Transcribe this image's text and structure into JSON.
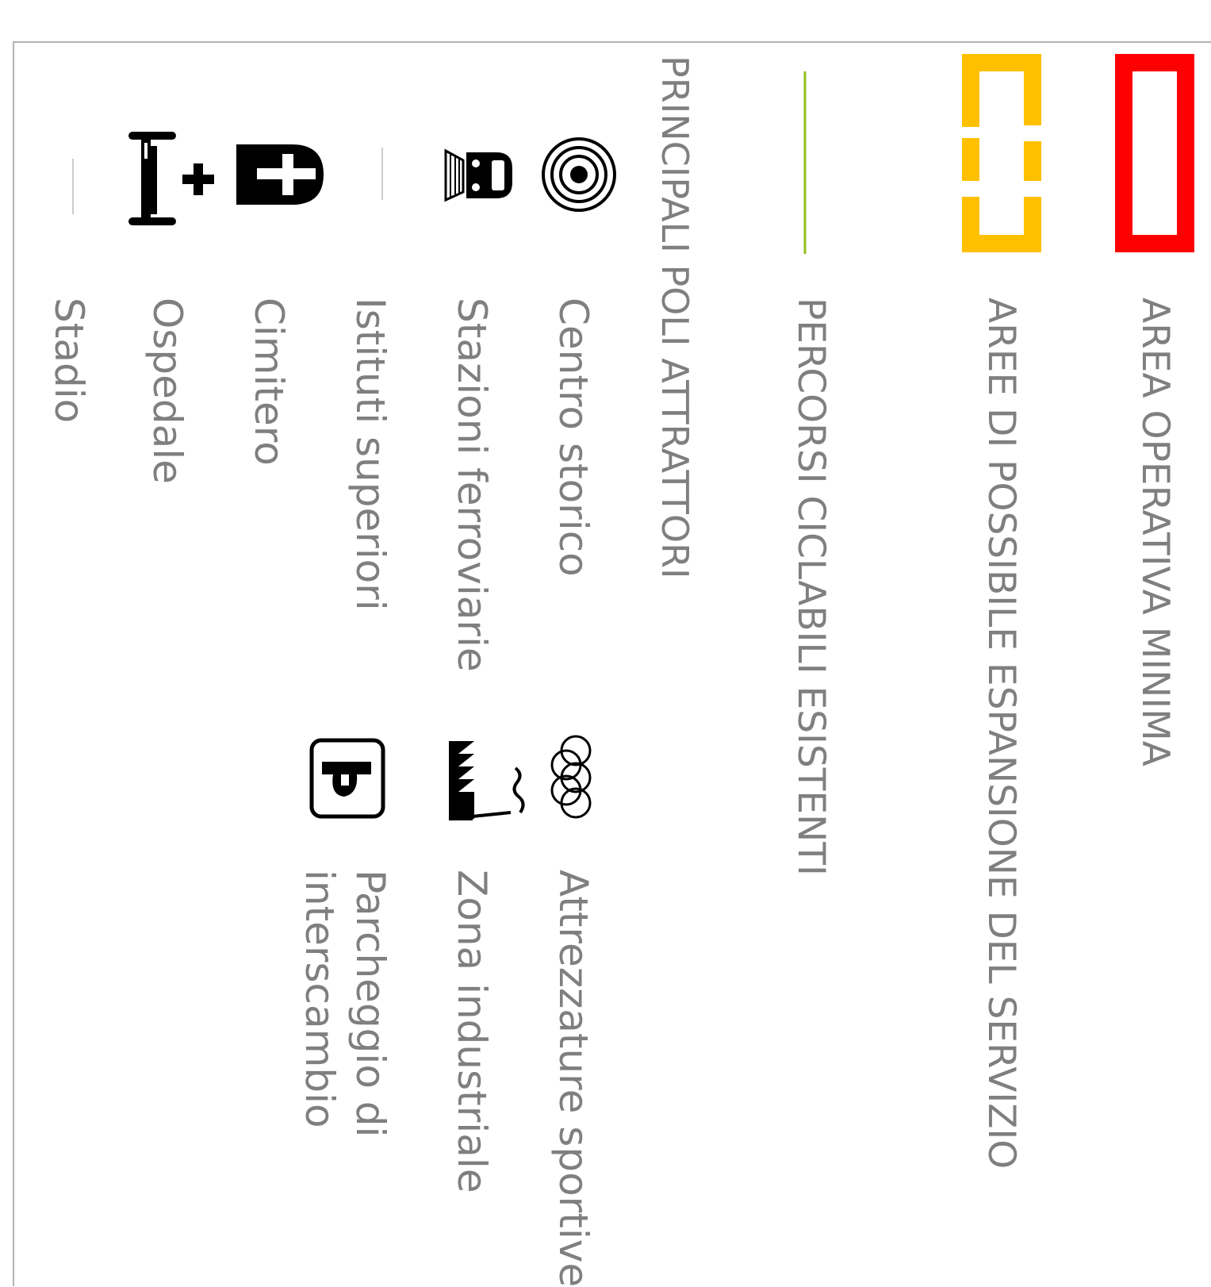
{
  "legend": {
    "sections": {
      "area_operativa": "AREA OPERATIVA MINIMA",
      "aree_espansione": "AREE DI POSSIBILE ESPANSIONE DEL SERVIZIO",
      "percorsi_ciclabili": "PERCORSI CICLABILI ESISTENTI",
      "poli_attrattori": "PRINCIPALI POLI ATTRATTORI"
    },
    "items": {
      "centro_storico": "Centro storico",
      "stazioni_ferroviarie": "Stazioni ferroviarie",
      "istituti_superiori": "Istituti superiori",
      "cimitero": "Cimitero",
      "ospedale": "Ospedale",
      "stadio": "Stadio",
      "attrezzature_sportive": "Attrezzature sportive",
      "zona_industriale": "Zona industriale",
      "parcheggio_line1": "Parcheggio di",
      "parcheggio_line2": "interscambio"
    },
    "icons": {
      "area_operativa": "red-rectangle-icon",
      "aree_espansione": "dashed-yellow-rectangle-icon",
      "percorsi_ciclabili": "green-line-icon",
      "centro_storico": "concentric-circles-icon",
      "stazioni_ferroviarie": "train-icon",
      "cimitero": "tombstone-cross-icon",
      "ospedale": "hospital-bed-cross-icon",
      "attrezzature_sportive": "olympic-rings-icon",
      "zona_industriale": "factory-icon",
      "parcheggio": "parking-icon"
    },
    "colors": {
      "area_operativa": "#ff0000",
      "aree_espansione": "#ffc000",
      "percorsi_ciclabili": "#92c01f",
      "text": "#7f7f7f"
    }
  }
}
